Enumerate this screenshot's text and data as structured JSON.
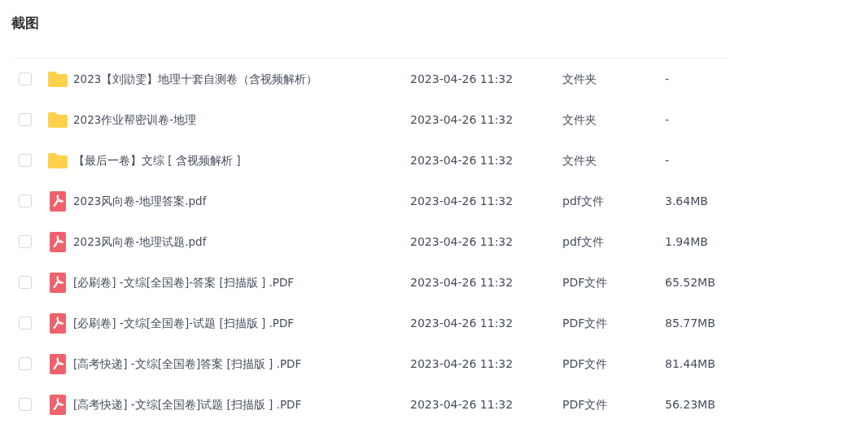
{
  "title": "截图",
  "files": [
    {
      "kind": "folder",
      "checked": false,
      "name": "2023【刘勖雯】地理十套自测卷（含视频解析）",
      "modified": "2023-04-26 11:32",
      "type": "文件夹",
      "size": "-"
    },
    {
      "kind": "folder",
      "checked": false,
      "name": "2023作业帮密训卷-地理",
      "modified": "2023-04-26 11:32",
      "type": "文件夹",
      "size": "-"
    },
    {
      "kind": "folder",
      "checked": false,
      "name": "【最后一卷】文综 [ 含视频解析 ]",
      "modified": "2023-04-26 11:32",
      "type": "文件夹",
      "size": "-"
    },
    {
      "kind": "pdf",
      "checked": false,
      "name": "2023风向卷-地理答案.pdf",
      "modified": "2023-04-26 11:32",
      "type": "pdf文件",
      "size": "3.64MB"
    },
    {
      "kind": "pdf",
      "checked": false,
      "name": "2023风向卷-地理试题.pdf",
      "modified": "2023-04-26 11:32",
      "type": "pdf文件",
      "size": "1.94MB"
    },
    {
      "kind": "pdf",
      "checked": false,
      "name": "[必刷卷] -文综[全国卷]-答案 [扫描版 ] .PDF",
      "modified": "2023-04-26 11:32",
      "type": "PDF文件",
      "size": "65.52MB"
    },
    {
      "kind": "pdf",
      "checked": false,
      "name": "[必刷卷] -文综[全国卷]-试题 [扫描版 ] .PDF",
      "modified": "2023-04-26 11:32",
      "type": "PDF文件",
      "size": "85.77MB"
    },
    {
      "kind": "pdf",
      "checked": false,
      "name": "[高考快递] -文综[全国卷]答案 [扫描版 ] .PDF",
      "modified": "2023-04-26 11:32",
      "type": "PDF文件",
      "size": "81.44MB"
    },
    {
      "kind": "pdf",
      "checked": false,
      "name": "[高考快递] -文综[全国卷]试题 [扫描版 ] .PDF",
      "modified": "2023-04-26 11:32",
      "type": "PDF文件",
      "size": "56.23MB"
    }
  ]
}
